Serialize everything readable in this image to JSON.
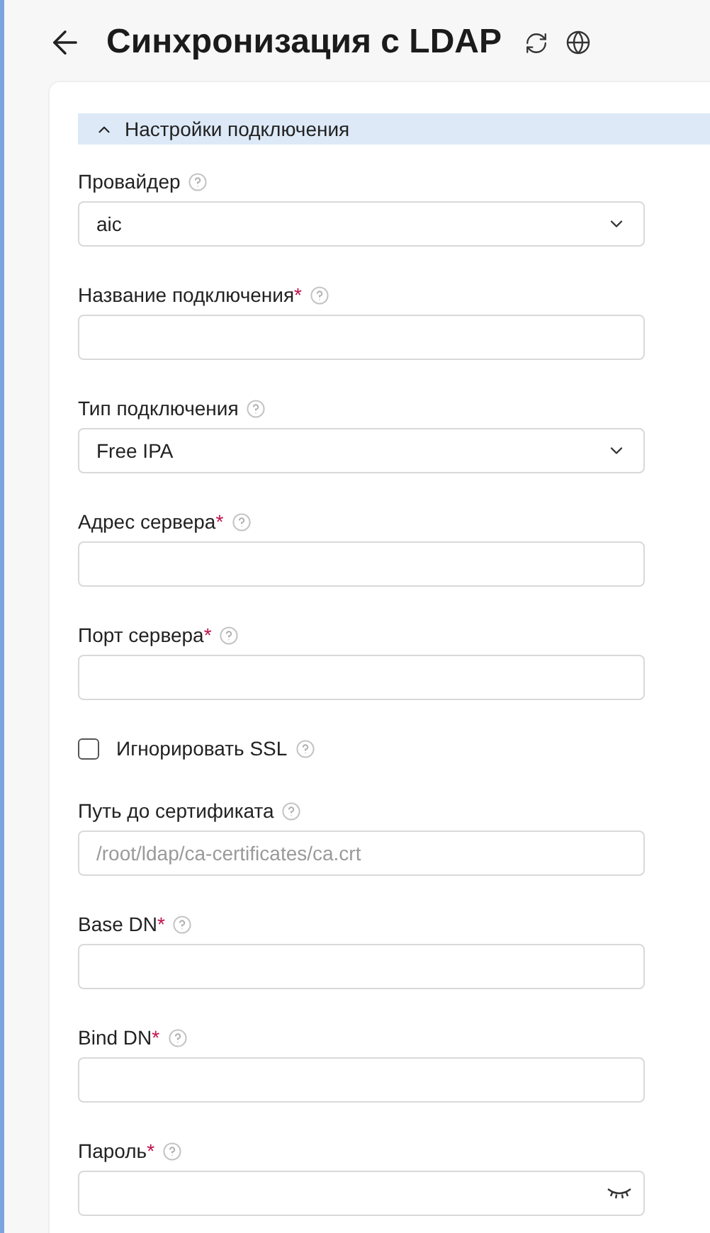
{
  "header": {
    "title": "Синхронизация с LDAP"
  },
  "section": {
    "title": "Настройки подключения",
    "expanded": true
  },
  "fields": [
    {
      "kind": "select",
      "label": "Провайдер",
      "value": "aic"
    },
    {
      "kind": "input",
      "label": "Название подключения",
      "required_mark": "*"
    },
    {
      "kind": "select",
      "label": "Тип подключения",
      "value": "Free IPA"
    },
    {
      "kind": "input",
      "label": "Адрес сервера",
      "required_mark": "*"
    },
    {
      "kind": "input",
      "label": "Порт сервера",
      "required_mark": "*"
    },
    {
      "kind": "checkbox",
      "label": "Игнорировать SSL",
      "checked": false
    },
    {
      "kind": "input",
      "label": "Путь до сертификата",
      "placeholder": "/root/ldap/ca-certificates/ca.crt"
    },
    {
      "kind": "input",
      "label": "Base DN",
      "required_mark": "*"
    },
    {
      "kind": "input",
      "label": "Bind DN",
      "required_mark": "*"
    },
    {
      "kind": "password",
      "label": "Пароль",
      "required_mark": "*"
    }
  ]
}
